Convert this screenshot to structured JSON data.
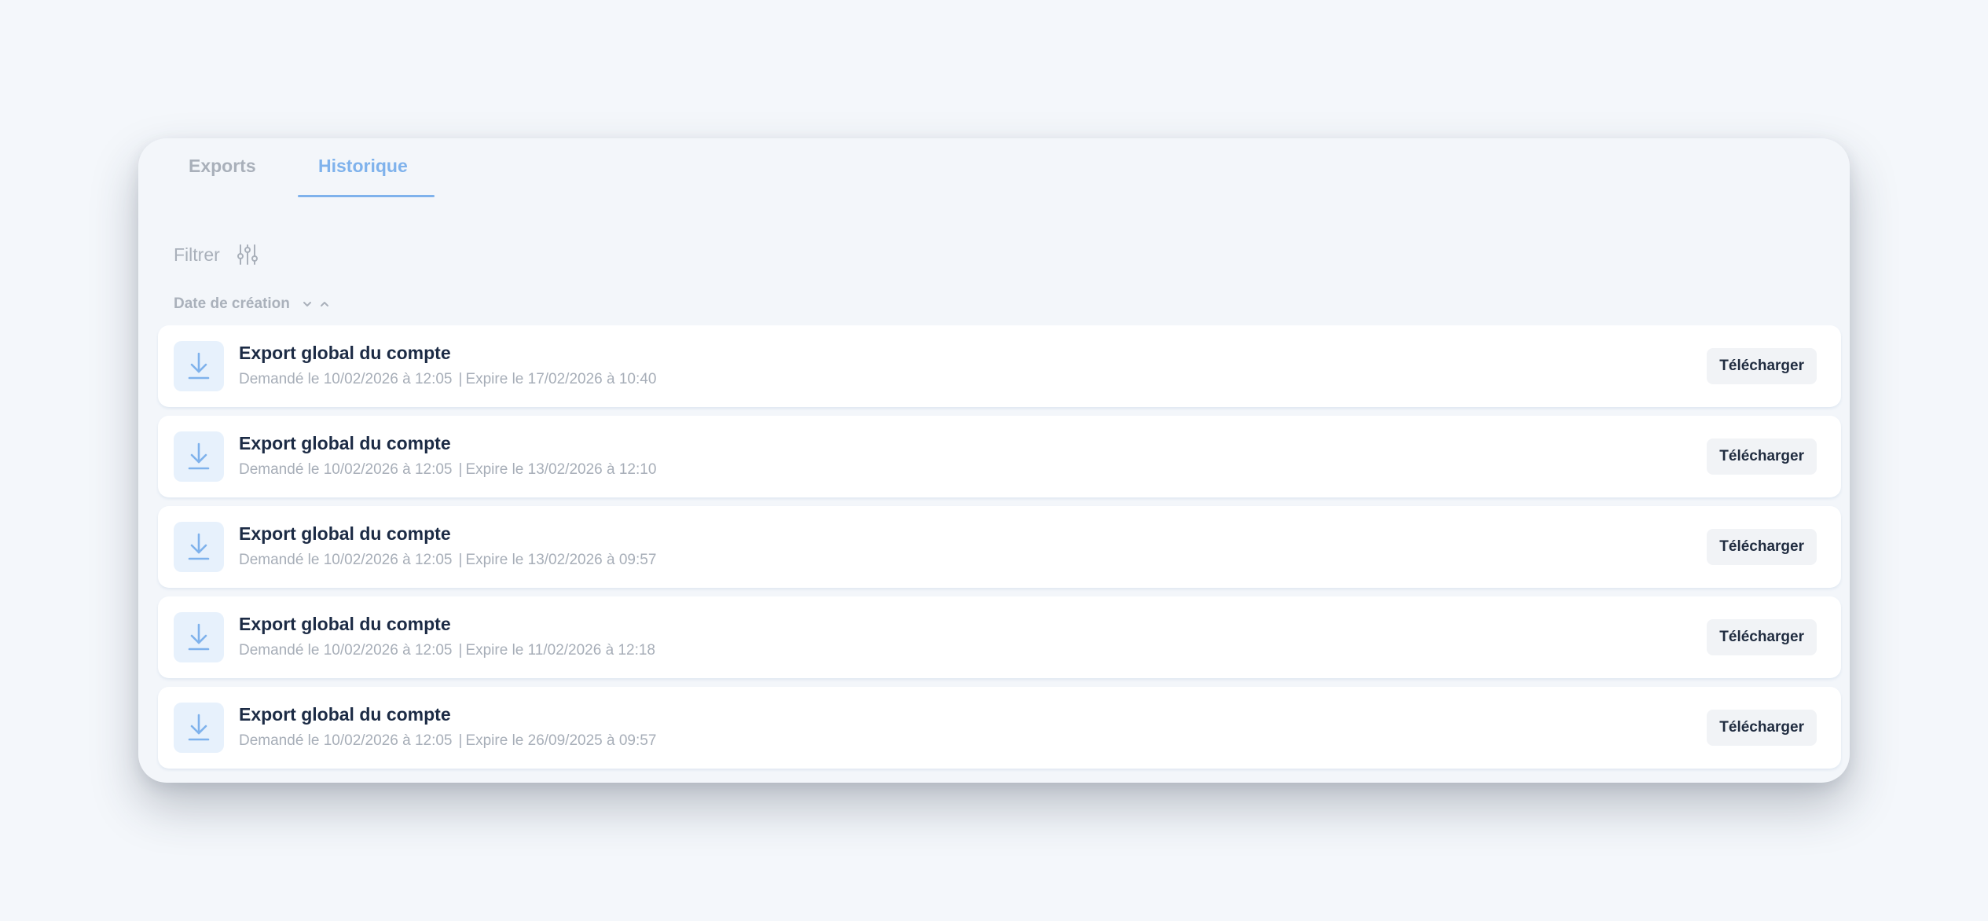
{
  "tabs": {
    "exports": "Exports",
    "historique": "Historique",
    "active": "historique"
  },
  "filter": {
    "label": "Filtrer",
    "icon": "sliders-icon"
  },
  "sort": {
    "label": "Date de création",
    "icons": [
      "chevron-down-icon",
      "chevron-up-icon"
    ]
  },
  "colors": {
    "accent": "#7fb2ec",
    "title": "#1c2b45",
    "muted": "#a9b0ba",
    "icon_bg": "#e7f1fc"
  },
  "rows": [
    {
      "icon": "download-icon",
      "title": "Export global du compte",
      "requested": "Demandé le 10/02/2026 à 12:05",
      "separator": "|",
      "expires": "Expire le 17/02/2026 à 10:40",
      "button": "Télécharger"
    },
    {
      "icon": "download-icon",
      "title": "Export global du compte",
      "requested": "Demandé le 10/02/2026 à 12:05",
      "separator": "|",
      "expires": "Expire le 13/02/2026 à 12:10",
      "button": "Télécharger"
    },
    {
      "icon": "download-icon",
      "title": "Export global du compte",
      "requested": "Demandé le 10/02/2026 à 12:05",
      "separator": "|",
      "expires": "Expire le 13/02/2026 à 09:57",
      "button": "Télécharger"
    },
    {
      "icon": "download-icon",
      "title": "Export global du compte",
      "requested": "Demandé le 10/02/2026 à 12:05",
      "separator": "|",
      "expires": "Expire le 11/02/2026 à 12:18",
      "button": "Télécharger"
    },
    {
      "icon": "download-icon",
      "title": "Export global du compte",
      "requested": "Demandé le 10/02/2026 à 12:05",
      "separator": "|",
      "expires": "Expire le 26/09/2025 à 09:57",
      "button": "Télécharger"
    }
  ]
}
